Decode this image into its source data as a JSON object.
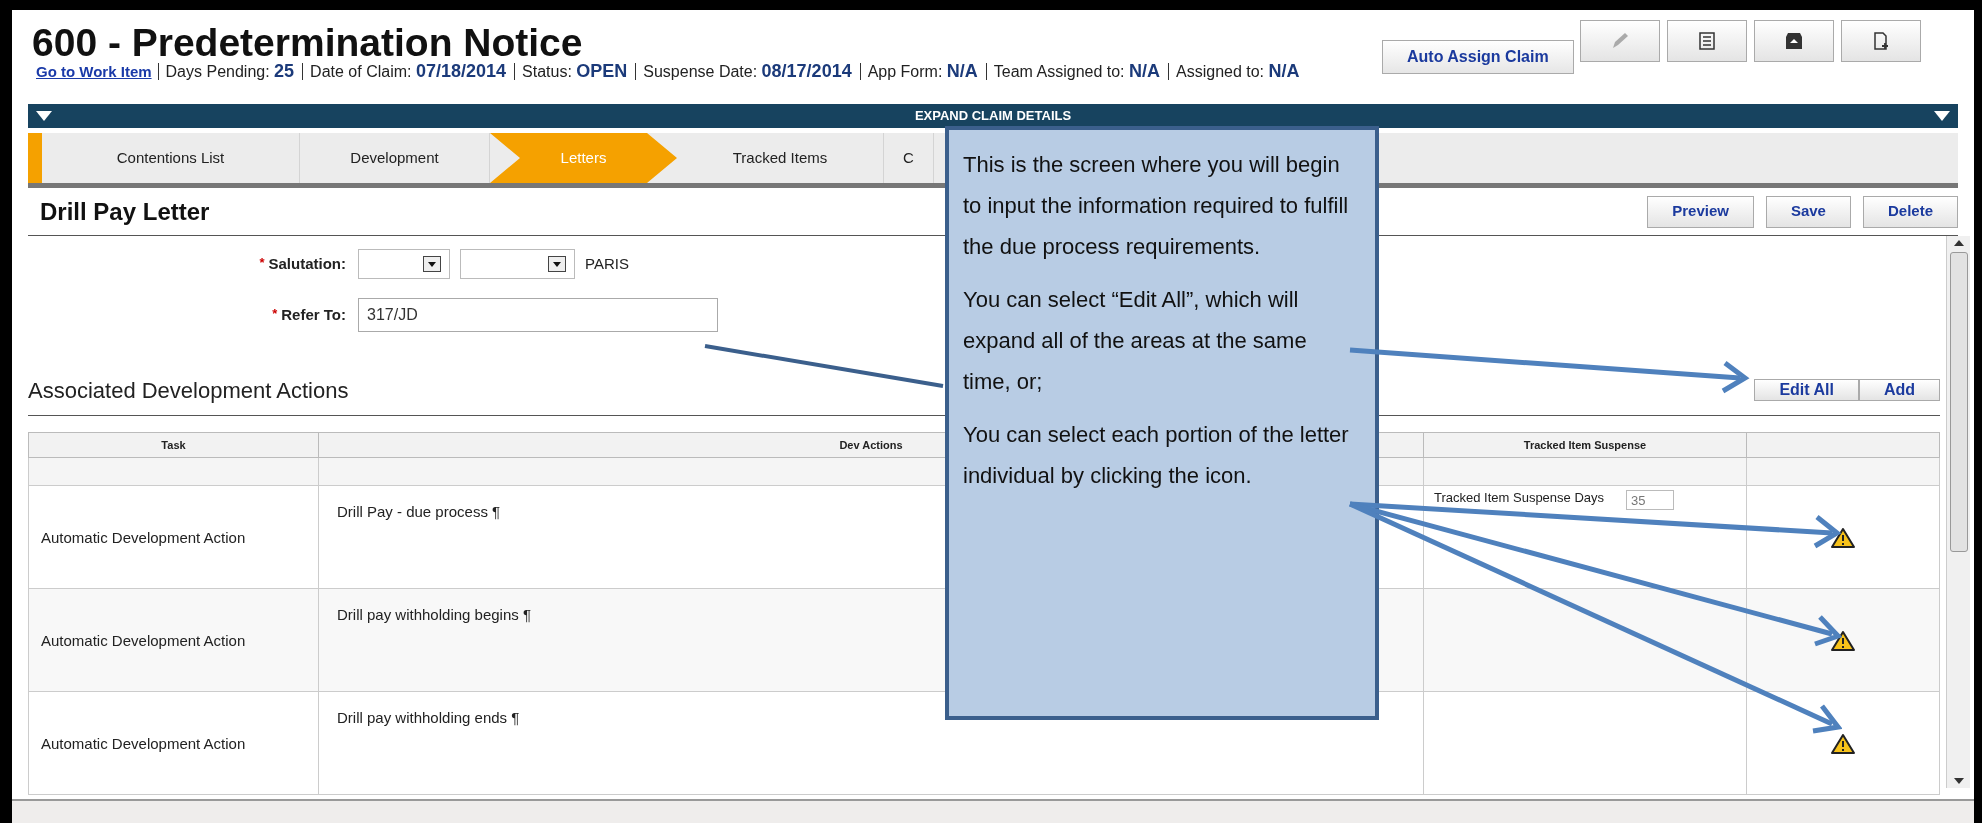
{
  "header": {
    "title": "600 - Predetermination Notice",
    "link": "Go to Work Item",
    "fields": [
      {
        "label": "Days Pending:",
        "value": "25"
      },
      {
        "label": "Date of Claim:",
        "value": "07/18/2014"
      },
      {
        "label": "Status:",
        "value": "OPEN"
      },
      {
        "label": "Suspense Date:",
        "value": "08/17/2014"
      },
      {
        "label": "App Form:",
        "value": "N/A"
      },
      {
        "label": "Team Assigned to:",
        "value": "N/A"
      },
      {
        "label": "Assigned to:",
        "value": "N/A"
      }
    ],
    "assign_button": "Auto Assign Claim"
  },
  "expand_bar": {
    "label": "EXPAND CLAIM DETAILS"
  },
  "steps": [
    {
      "label": "Contentions List",
      "selected": false
    },
    {
      "label": "Development",
      "selected": false
    },
    {
      "label": "Letters",
      "selected": true
    },
    {
      "label": "Tracked Items",
      "selected": false
    },
    {
      "label": "C",
      "selected": false
    }
  ],
  "letter": {
    "title": "Drill Pay Letter",
    "buttons": [
      "Preview",
      "Save",
      "Delete"
    ]
  },
  "form": {
    "salutation": {
      "label": "Salutation:",
      "marker": "*",
      "text": "PARIS"
    },
    "refer_to": {
      "label": "Refer To:",
      "marker": "*",
      "value": "317/JD"
    }
  },
  "section": {
    "title": "Associated Development Actions",
    "buttons": [
      "Edit All",
      "Add"
    ]
  },
  "table": {
    "columns": [
      "Task",
      "Dev Actions",
      "Tracked Item Suspense"
    ],
    "rows": [
      {
        "task": "Automatic Development Action",
        "action": "Drill Pay - due process ¶",
        "suspense_label": "Tracked Item Suspense Days",
        "suspense_value": "35",
        "warning": true
      },
      {
        "task": "Automatic Development Action",
        "action": "Drill pay withholding begins ¶",
        "warning": true
      },
      {
        "task": "Automatic Development Action",
        "action": "Drill pay withholding ends ¶",
        "warning": true
      }
    ]
  },
  "callout": {
    "paragraphs": [
      "This is the screen where you will begin to input the information required to fulfill the due process requirements.",
      "You can select “Edit All”, which will expand all of the areas at the same time, or;",
      "You can select each portion of the letter individual by clicking the icon."
    ]
  }
}
